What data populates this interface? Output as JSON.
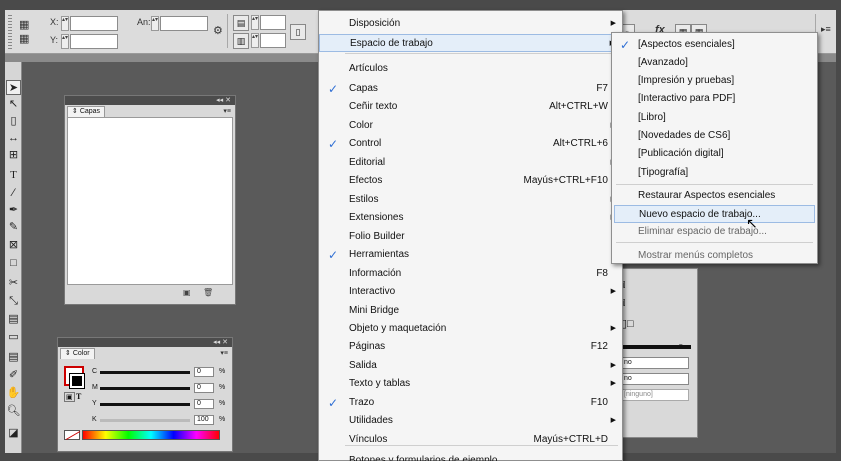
{
  "control": {
    "x_label": "X:",
    "y_label": "Y:",
    "w_label": "An:"
  },
  "panels": {
    "capas": {
      "tab": "Capas"
    },
    "color": {
      "tab": "Color",
      "channels": [
        {
          "label": "C",
          "value": "0",
          "unit": "%"
        },
        {
          "label": "M",
          "value": "0",
          "unit": "%"
        },
        {
          "label": "Y",
          "value": "0",
          "unit": "%"
        },
        {
          "label": "K",
          "value": "100",
          "unit": "%"
        }
      ],
      "t_label": "T"
    }
  },
  "main_menu": {
    "items": [
      {
        "label": "Disposición",
        "submenu": true
      },
      {
        "label": "Espacio de trabajo",
        "submenu": true,
        "highlighted": true
      },
      {
        "label": "Artículos"
      },
      {
        "label": "Capas",
        "shortcut": "F7",
        "checked": true
      },
      {
        "label": "Ceñir texto",
        "shortcut": "Alt+CTRL+W"
      },
      {
        "label": "Color",
        "submenu": true
      },
      {
        "label": "Control",
        "shortcut": "Alt+CTRL+6",
        "checked": true
      },
      {
        "label": "Editorial",
        "submenu": true
      },
      {
        "label": "Efectos",
        "shortcut": "Mayús+CTRL+F10"
      },
      {
        "label": "Estilos",
        "submenu": true
      },
      {
        "label": "Extensiones",
        "submenu": true
      },
      {
        "label": "Folio Builder"
      },
      {
        "label": "Herramientas",
        "checked": true
      },
      {
        "label": "Información",
        "shortcut": "F8"
      },
      {
        "label": "Interactivo",
        "submenu": true
      },
      {
        "label": "Mini Bridge"
      },
      {
        "label": "Objeto y maquetación",
        "submenu": true
      },
      {
        "label": "Páginas",
        "shortcut": "F12"
      },
      {
        "label": "Salida",
        "submenu": true
      },
      {
        "label": "Texto y tablas",
        "submenu": true
      },
      {
        "label": "Trazo",
        "shortcut": "F10",
        "checked": true
      },
      {
        "label": "Utilidades",
        "submenu": true
      },
      {
        "label": "Vínculos",
        "shortcut": "Mayús+CTRL+D"
      },
      {
        "label": "Botones y formularios de ejemplo"
      }
    ]
  },
  "workspace_menu": {
    "items": [
      {
        "label": "[Aspectos esenciales]",
        "checked": true
      },
      {
        "label": "[Avanzado]"
      },
      {
        "label": "[Impresión y pruebas]"
      },
      {
        "label": "[Interactivo para PDF]"
      },
      {
        "label": "[Libro]"
      },
      {
        "label": "[Novedades de CS6]"
      },
      {
        "label": "[Publicación digital]"
      },
      {
        "label": "[Tipografía]"
      },
      {
        "label": "Restaurar Aspectos esenciales"
      },
      {
        "label": "Nuevo espacio de trabajo...",
        "highlighted": true
      },
      {
        "label": "Eliminar espacio de trabajo..."
      },
      {
        "label": "Mostrar menús completos"
      }
    ]
  },
  "right_panel": {
    "fields": [
      "no",
      "no",
      "[ninguno]"
    ]
  },
  "colors": {
    "menu_check": "#2f6fd4",
    "highlight_bg": "#e4eef9",
    "highlight_border": "#9cbbe3"
  }
}
